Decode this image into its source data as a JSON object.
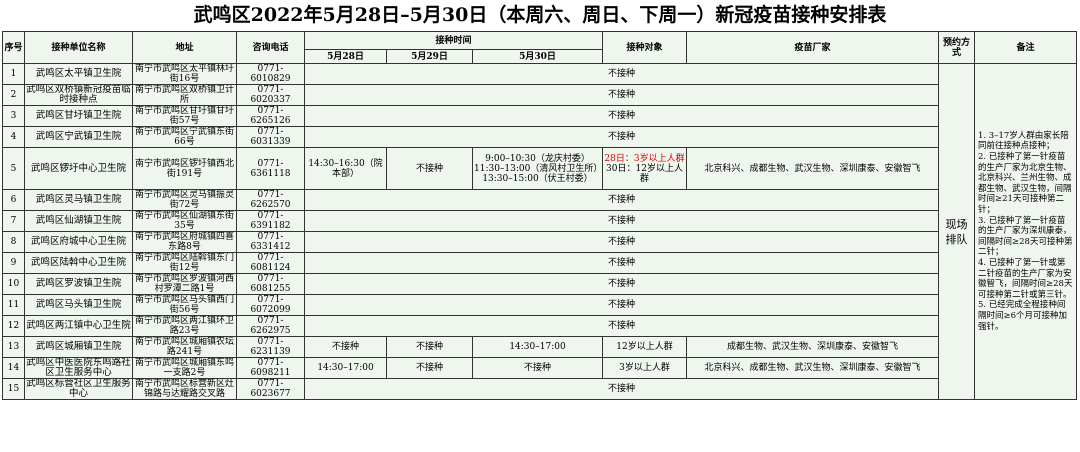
{
  "title": "武鸣区2022年5月28日–5月30日（本周六、周日、下周一）新冠疫苗接种安排表",
  "headers": {
    "seq": "序号",
    "unit": "接种单位名称",
    "address": "地址",
    "phone": "咨询电话",
    "time": "接种时间",
    "day1": "5月28日",
    "day2": "5月29日",
    "day3": "5月30日",
    "target": "接种对象",
    "maker": "疫苗厂家",
    "reserve": "预约方式",
    "remark": "备注"
  },
  "no_vaccination": "不接种",
  "reserve_value": "现场排队",
  "rows": [
    {
      "n": "1",
      "unit": "武鸣区太平镇卫生院",
      "addr": "南宁市武鸣区太平镇林圩街16号",
      "phone": "0771-6010829"
    },
    {
      "n": "2",
      "unit": "武鸣区双桥镇新冠疫苗临时接种点",
      "addr": "南宁市武鸣区双桥镇卫计所",
      "phone": "0771-6020337"
    },
    {
      "n": "3",
      "unit": "武鸣区甘圩镇卫生院",
      "addr": "南宁市武鸣区甘圩镇甘圩街57号",
      "phone": "0771-6265126"
    },
    {
      "n": "4",
      "unit": "武鸣区宁武镇卫生院",
      "addr": "南宁市武鸣区宁武镇东街66号",
      "phone": "0771-6031339"
    },
    {
      "n": "5",
      "unit": "武鸣区锣圩中心卫生院",
      "addr": "南宁市武鸣区锣圩镇西北街191号",
      "phone": "0771-6361118",
      "d1": "14:30–16:30（院本部）",
      "d2": "不接种",
      "d3a": "9:00–10:30（龙庆村委）",
      "d3b": "11:30–13:00（清风村卫生所）",
      "d3c": "13:30–15:00（伏王村委）",
      "target_red": "28日：3岁以上人群",
      "target_b": "30日：12岁以上人群",
      "maker": "北京科兴、成都生物、武汉生物、深圳康泰、安徽智飞"
    },
    {
      "n": "6",
      "unit": "武鸣区灵马镇卫生院",
      "addr": "南宁市武鸣区灵马镇振灵街72号",
      "phone": "0771-6262570"
    },
    {
      "n": "7",
      "unit": "武鸣区仙湖镇卫生院",
      "addr": "南宁市武鸣区仙湖镇东街35号",
      "phone": "0771-6391182"
    },
    {
      "n": "8",
      "unit": "武鸣区府城中心卫生院",
      "addr": "南宁市武鸣区府城镇四喜东路8号",
      "phone": "0771-6331412"
    },
    {
      "n": "9",
      "unit": "武鸣区陆斡中心卫生院",
      "addr": "南宁市武鸣区陆斡镇东门街12号",
      "phone": "0771-6081124"
    },
    {
      "n": "10",
      "unit": "武鸣区罗波镇卫生院",
      "addr": "南宁市武鸣区罗波镇河西村罗潭二路1号",
      "phone": "0771-6081255"
    },
    {
      "n": "11",
      "unit": "武鸣区马头镇卫生院",
      "addr": "南宁市武鸣区马头镇西门街56号",
      "phone": "0771-6072099"
    },
    {
      "n": "12",
      "unit": "武鸣区两江镇中心卫生院",
      "addr": "南宁市武鸣区两江镇环卫路23号",
      "phone": "0771-6262975"
    },
    {
      "n": "13",
      "unit": "武鸣区城厢镇卫生院",
      "addr": "南宁市武鸣区城厢镇农坛路241号",
      "phone": "0771-6231139",
      "d1": "不接种",
      "d2": "不接种",
      "d3": "14:30–17:00",
      "target": "12岁以上人群",
      "maker": "成都生物、武汉生物、深圳康泰、安徽智飞"
    },
    {
      "n": "14",
      "unit": "武鸣区中医医院东鸣路社区卫生服务中心",
      "addr": "南宁市武鸣区城厢镇东鸣一支路2号",
      "phone": "0771-6098211",
      "d1": "14:30–17:00",
      "d2": "不接种",
      "d3": "不接种",
      "target": "3岁以上人群",
      "maker": "北京科兴、成都生物、武汉生物、深圳康泰、安徽智飞"
    },
    {
      "n": "15",
      "unit": "武鸣区标营社区卫生服务中心",
      "addr": "南宁市武鸣区标营新区灶锦路与达耀路交叉路",
      "phone": "0771-6023677"
    }
  ],
  "notes": [
    "1. 3–17岁人群由家长陪同前往接种点接种；",
    "2. 已接种了第一针疫苗的生产厂家为北京生物、北京科兴、兰州生物、成都生物、武汉生物，间隔时间≥21天可接种第二针；",
    "3. 已接种了第一针疫苗的生产厂家为深圳康泰，间隔时间≥28天可接种第二针；",
    "4. 已接种了第一针或第二针疫苗的生产厂家为安徽智飞，间隔时间≥28天可接种第二针或第三针。",
    "5. 已经完成全程接种间隔时间≥6个月可接种加强针。"
  ]
}
